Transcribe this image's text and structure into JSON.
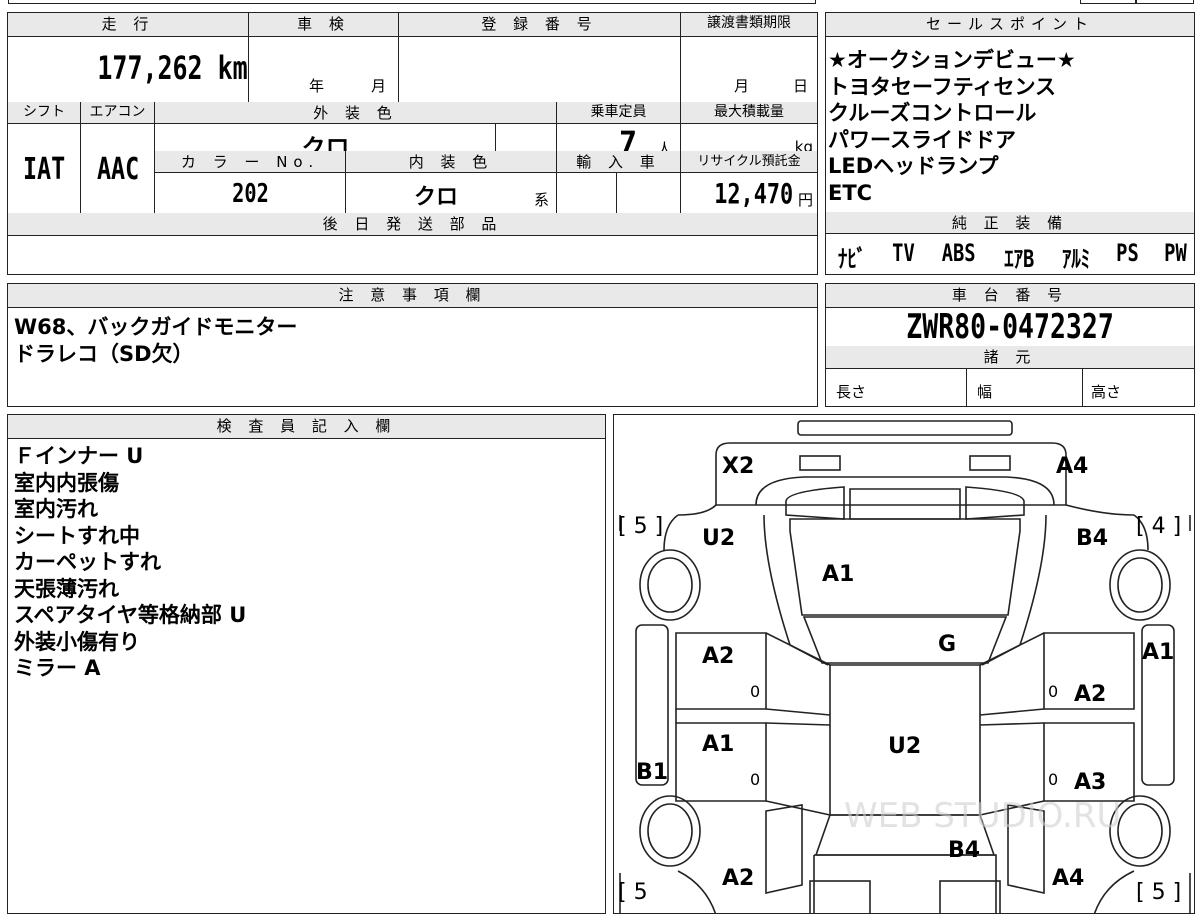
{
  "header": {
    "mileage_label": "走 行",
    "mileage_value": "177,262",
    "mileage_unit": "km",
    "inspection_label": "車 検",
    "inspection_year": "年",
    "inspection_month": "月",
    "registration_label": "登 録 番 号",
    "transfer_label": "譲渡書類期限",
    "transfer_month": "月",
    "transfer_day": "日",
    "shift_label": "シフト",
    "shift_value": "IAT",
    "ac_label": "エアコン",
    "ac_value": "AAC",
    "exterior_label": "外 装 色",
    "exterior_value": "クロ",
    "capacity_label": "乗車定員",
    "capacity_value": "7",
    "capacity_unit": "人",
    "max_load_label": "最大積載量",
    "max_load_unit": "kg",
    "color_no_label": "カ ラ ー No.",
    "color_no_value": "202",
    "interior_label": "内 装 色",
    "interior_value": "クロ",
    "interior_suffix": "系",
    "import_label": "輸 入 車",
    "recycle_label": "リサイクル預託金",
    "recycle_value": "12,470",
    "recycle_unit": "円",
    "later_parts_label": "後 日 発 送 部 品"
  },
  "sales_points": {
    "title": "セールスポイント",
    "items": [
      "★オークションデビュー★",
      "トヨタセーフティセンス",
      "クルーズコントロール",
      "パワースライドドア",
      "LEDヘッドランプ",
      "ETC"
    ]
  },
  "equipment": {
    "title": "純 正 装 備",
    "items": [
      "ﾅﾋﾞ",
      "TV",
      "ABS",
      "ｴｱB",
      "ｱﾙﾐ",
      "PS",
      "PW"
    ]
  },
  "notes": {
    "title": "注 意 事 項 欄",
    "lines": [
      "W68、バックガイドモニター",
      "ドラレコ（SD欠）"
    ]
  },
  "chassis": {
    "title": "車 台 番 号",
    "value": "ZWR80-0472327"
  },
  "specs": {
    "title": "諸 元",
    "length": "長さ",
    "width": "幅",
    "height": "高さ"
  },
  "inspector": {
    "title": "検 査 員 記 入 欄",
    "lines": [
      "Ｆインナー U",
      "室内内張傷",
      "室内汚れ",
      "シートすれ中",
      "カーペットすれ",
      "天張薄汚れ",
      "スペアタイヤ等格納部 U",
      "外装小傷有り",
      "ミラー A"
    ]
  },
  "diagram": {
    "marks": {
      "x2": "X2",
      "a4_top": "A4",
      "tire_fl": "[ 5 ]",
      "tire_fr": "[ 4 ]",
      "u2_left": "U2",
      "b4_right": "B4",
      "a1_hood": "A1",
      "g_glass": "G",
      "a1_right": "A1",
      "a2_left_front": "A2",
      "a2_right_front": "A2",
      "a1_left_rear": "A1",
      "u2_roof": "U2",
      "a3_right": "A3",
      "b1_left": "B1",
      "b4_rear": "B4",
      "a2_bottom": "A2",
      "a4_bottom": "A4",
      "tire_rl": "[ 5",
      "tire_rr": "[ 5 ]",
      "zero_1": "0",
      "zero_2": "0",
      "zero_3": "0",
      "zero_4": "0"
    },
    "watermark": "WEB STUDIO.RU"
  }
}
